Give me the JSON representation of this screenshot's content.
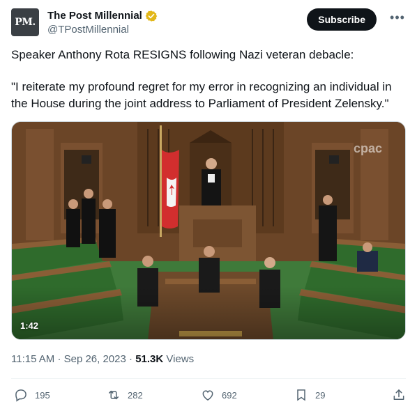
{
  "author": {
    "avatar_text": "PM.",
    "display_name": "The Post Millennial",
    "handle": "@TPostMillennial",
    "verified": true
  },
  "header": {
    "subscribe_label": "Subscribe",
    "more_label": "•••"
  },
  "tweet": {
    "text_line1": "Speaker Anthony Rota RESIGNS following Nazi veteran debacle:",
    "text_line2": "\"I reiterate my profound regret for my error in recognizing an individual in the House during the joint address to Parliament of President Zelensky.\""
  },
  "media": {
    "duration": "1:42",
    "watermark": "cpac"
  },
  "meta": {
    "time": "11:15 AM",
    "date": "Sep 26, 2023",
    "views_count": "51.3K",
    "views_label": "Views"
  },
  "actions": {
    "replies": "195",
    "reposts": "282",
    "likes": "692",
    "bookmarks": "29"
  },
  "colors": {
    "accent": "#0f1419",
    "muted": "#536471",
    "verified_badge": "#e2b719"
  }
}
